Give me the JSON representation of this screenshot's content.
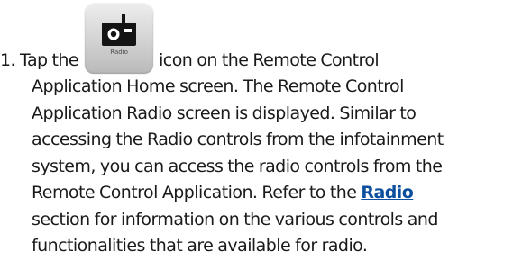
{
  "step": {
    "number": "1.",
    "tap_text": "Tap the",
    "icon": {
      "name": "radio-icon",
      "label": "Radio"
    },
    "line1_after_icon": "icon on the Remote Control",
    "line2": "Application Home screen. The Remote Control",
    "line3": "Application Radio screen is displayed. Similar to",
    "line4": "accessing the Radio controls from the infotainment",
    "line5": "system, you can access the radio controls from the",
    "line6_before_link": "Remote Control Application. Refer to the ",
    "link_text": "Radio",
    "line7": "section for information on the various controls and",
    "line8": "functionalities that are available for radio.",
    "colors": {
      "text": "#1a1a1a",
      "link": "#0b4f9e"
    }
  }
}
